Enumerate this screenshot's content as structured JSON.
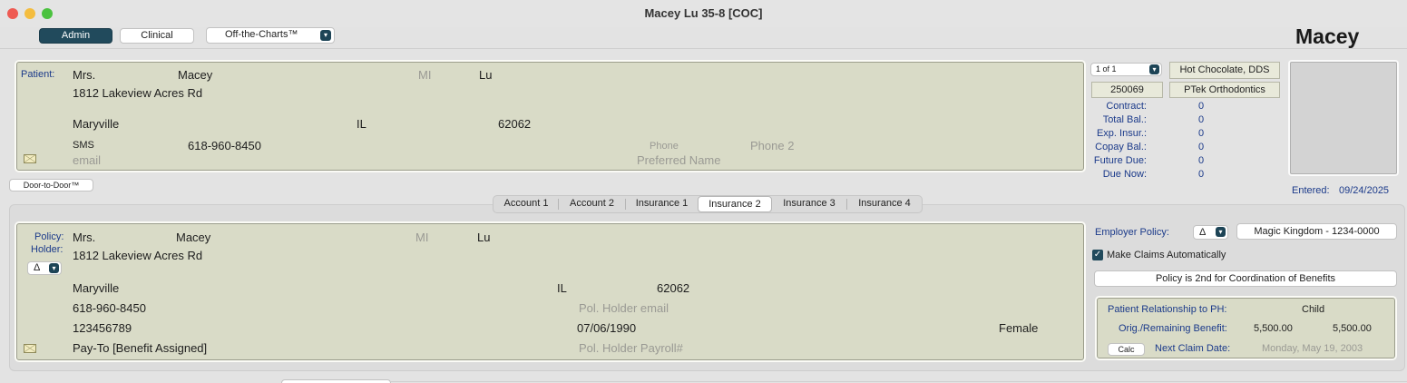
{
  "window": {
    "title": "Macey Lu 35-8 [COC]"
  },
  "toolbar": {
    "admin": "Admin",
    "clinical": "Clinical",
    "off_the_charts": "Off-the-Charts™",
    "patient_first_big": "Macey"
  },
  "patient": {
    "label": "Patient:",
    "prefix": "Mrs.",
    "first": "Macey",
    "mi_placeholder": "MI",
    "last": "Lu",
    "address": "1812 Lakeview Acres Rd",
    "city": "Maryville",
    "state": "IL",
    "zip": "62062",
    "sms_label": "SMS",
    "sms": "618-960-8450",
    "phone_placeholder": "Phone",
    "phone2_placeholder": "Phone 2",
    "email_placeholder": "email",
    "preferred_placeholder": "Preferred Name"
  },
  "door_to_door": "Door-to-Door™",
  "account": {
    "page_selector": "1 of 1",
    "doctor": "Hot Chocolate, DDS",
    "account_no": "250069",
    "practice": "PTek Orthodontics",
    "balances": [
      {
        "label": "Contract:",
        "value": "0"
      },
      {
        "label": "Total Bal.:",
        "value": "0"
      },
      {
        "label": "Exp. Insur.:",
        "value": "0"
      },
      {
        "label": "Copay Bal.:",
        "value": "0"
      },
      {
        "label": "Future Due:",
        "value": "0"
      },
      {
        "label": "Due Now:",
        "value": "0"
      }
    ],
    "entered_label": "Entered:",
    "entered_date": "09/24/2025"
  },
  "tabs": [
    "Account 1",
    "Account 2",
    "Insurance 1",
    "Insurance 2",
    "Insurance 3",
    "Insurance 4"
  ],
  "policy_holder": {
    "label1": "Policy:",
    "label2": "Holder:",
    "delta": "Δ",
    "prefix": "Mrs.",
    "first": "Macey",
    "mi_placeholder": "MI",
    "last": "Lu",
    "address": "1812 Lakeview Acres Rd",
    "city": "Maryville",
    "state": "IL",
    "zip": "62062",
    "phone": "618-960-8450",
    "email_placeholder": "Pol. Holder email",
    "ssn": "123456789",
    "dob": "07/06/1990",
    "gender": "Female",
    "pay_to": "Pay-To [Benefit Assigned]",
    "payroll_placeholder": "Pol. Holder Payroll#"
  },
  "employer": {
    "label": "Employer Policy:",
    "delta": "Δ",
    "name": "Magic Kingdom - 1234-0000",
    "make_claims": "Make Claims Automatically",
    "cob": "Policy is 2nd for Coordination of Benefits",
    "relationship_label": "Patient Relationship to PH:",
    "relationship": "Child",
    "benefit_label": "Orig./Remaining Benefit:",
    "orig_benefit": "5,500.00",
    "remaining_benefit": "5,500.00",
    "calc": "Calc",
    "next_claim_label": "Next Claim Date:",
    "next_claim_date": "Monday, May 19, 2003"
  },
  "colors": {
    "accent": "#214a5c",
    "panel": "#d9dbc7",
    "label_blue": "#1b3a8a"
  }
}
